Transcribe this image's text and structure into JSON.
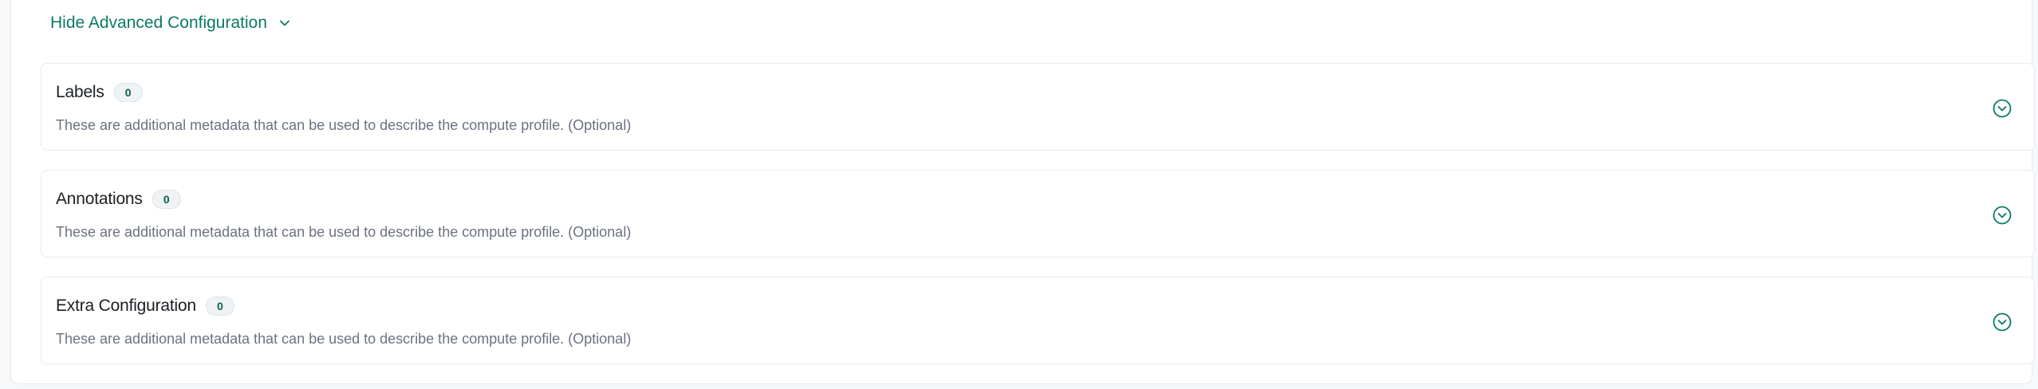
{
  "advanced": {
    "toggle_label": "Hide Advanced Configuration",
    "toggle_icon": "chevron-down-icon"
  },
  "sections": [
    {
      "title": "Labels",
      "count": "0",
      "description": "These are additional metadata that can be used to describe the compute profile. (Optional)",
      "icon": "chevron-down-circle-icon"
    },
    {
      "title": "Annotations",
      "count": "0",
      "description": "These are additional metadata that can be used to describe the compute profile. (Optional)",
      "icon": "chevron-down-circle-icon"
    },
    {
      "title": "Extra Configuration",
      "count": "0",
      "description": "These are additional metadata that can be used to describe the compute profile. (Optional)",
      "icon": "chevron-down-circle-icon"
    }
  ],
  "colors": {
    "accent": "#0a7a66",
    "title_text": "#1b1f23",
    "description_text": "#6b7280",
    "border": "#e8eaed"
  }
}
